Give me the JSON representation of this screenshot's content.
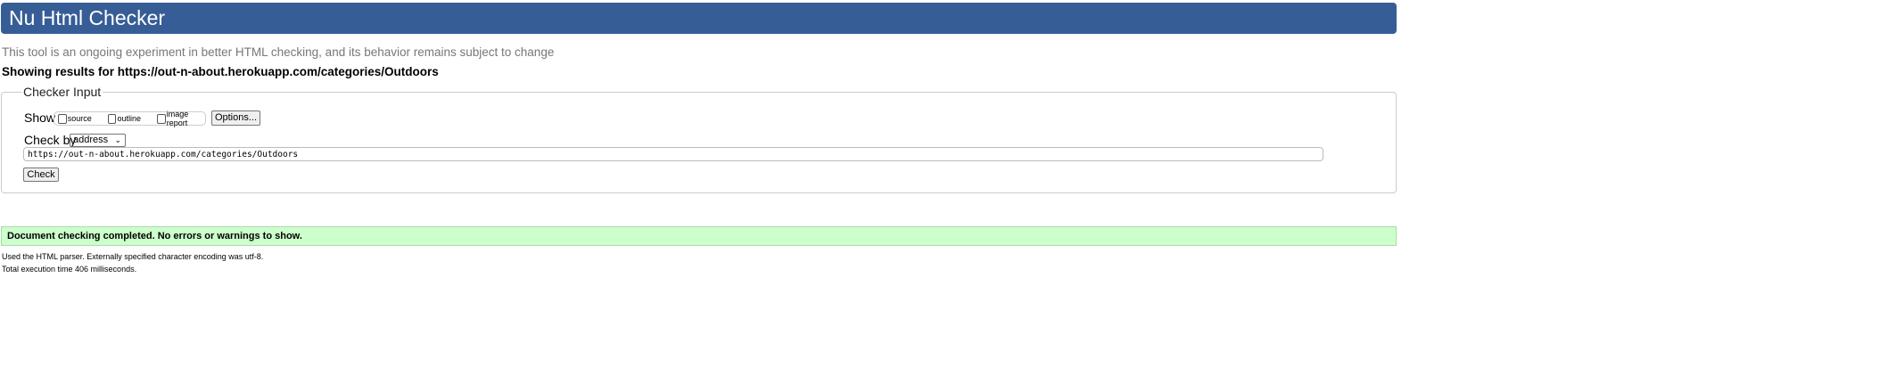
{
  "header": {
    "title": "Nu Html Checker"
  },
  "intro": "This tool is an ongoing experiment in better HTML checking, and its behavior remains subject to change",
  "showing": "Showing results for https://out-n-about.herokuapp.com/categories/Outdoors",
  "checker_input": {
    "legend": "Checker Input",
    "show_label": "Show",
    "show_options": [
      {
        "label": "source",
        "checked": false
      },
      {
        "label": "outline",
        "checked": false
      },
      {
        "label": "image report",
        "checked": false
      }
    ],
    "options_button": "Options...",
    "check_by_label": "Check by",
    "check_by_value": "address",
    "url_value": "https://out-n-about.herokuapp.com/categories/Outdoors",
    "check_button": "Check"
  },
  "result": {
    "message": "Document checking completed. No errors or warnings to show.",
    "color": "#ccffcc"
  },
  "details": [
    "Used the HTML parser. Externally specified character encoding was utf-8.",
    "Total execution time 406 milliseconds."
  ],
  "colors": {
    "header": "#365d96"
  }
}
